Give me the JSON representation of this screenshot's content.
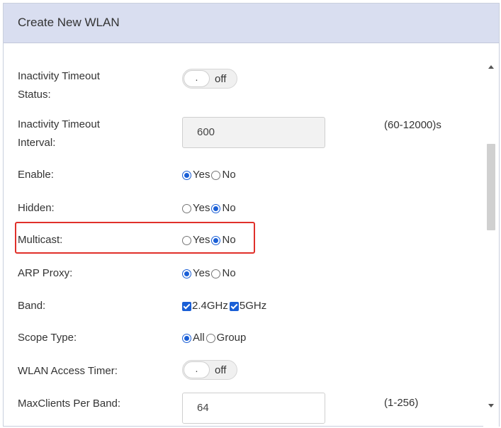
{
  "dialog": {
    "title": "Create New WLAN"
  },
  "fields": {
    "inactivity_status": {
      "label_line1": "Inactivity Timeout",
      "label_line2": "Status:",
      "knob": ".",
      "state": "off"
    },
    "inactivity_interval": {
      "label_line1": "Inactivity Timeout",
      "label_line2": "Interval:",
      "value": "600",
      "range": "(60-12000)s"
    },
    "enable": {
      "label": "Enable:",
      "opt_yes": "Yes",
      "opt_no": "No",
      "selected": "Yes"
    },
    "hidden": {
      "label": "Hidden:",
      "opt_yes": "Yes",
      "opt_no": "No",
      "selected": "No"
    },
    "multicast": {
      "label": "Multicast:",
      "opt_yes": "Yes",
      "opt_no": "No",
      "selected": "No"
    },
    "arp_proxy": {
      "label": "ARP Proxy:",
      "opt_yes": "Yes",
      "opt_no": "No",
      "selected": "Yes"
    },
    "band": {
      "label": "Band:",
      "opt_24": "2.4GHz",
      "opt_5": "5GHz",
      "checked": [
        "2.4GHz",
        "5GHz"
      ]
    },
    "scope_type": {
      "label": "Scope Type:",
      "opt_all": "All",
      "opt_group": "Group",
      "selected": "All"
    },
    "access_timer": {
      "label": "WLAN Access Timer:",
      "knob": ".",
      "state": "off"
    },
    "max_clients": {
      "label": "MaxClients Per Band:",
      "value": "64",
      "range": "(1-256)"
    }
  },
  "colors": {
    "header_bg": "#d9def0",
    "accent": "#1a5fd6",
    "highlight": "#e0302a"
  }
}
